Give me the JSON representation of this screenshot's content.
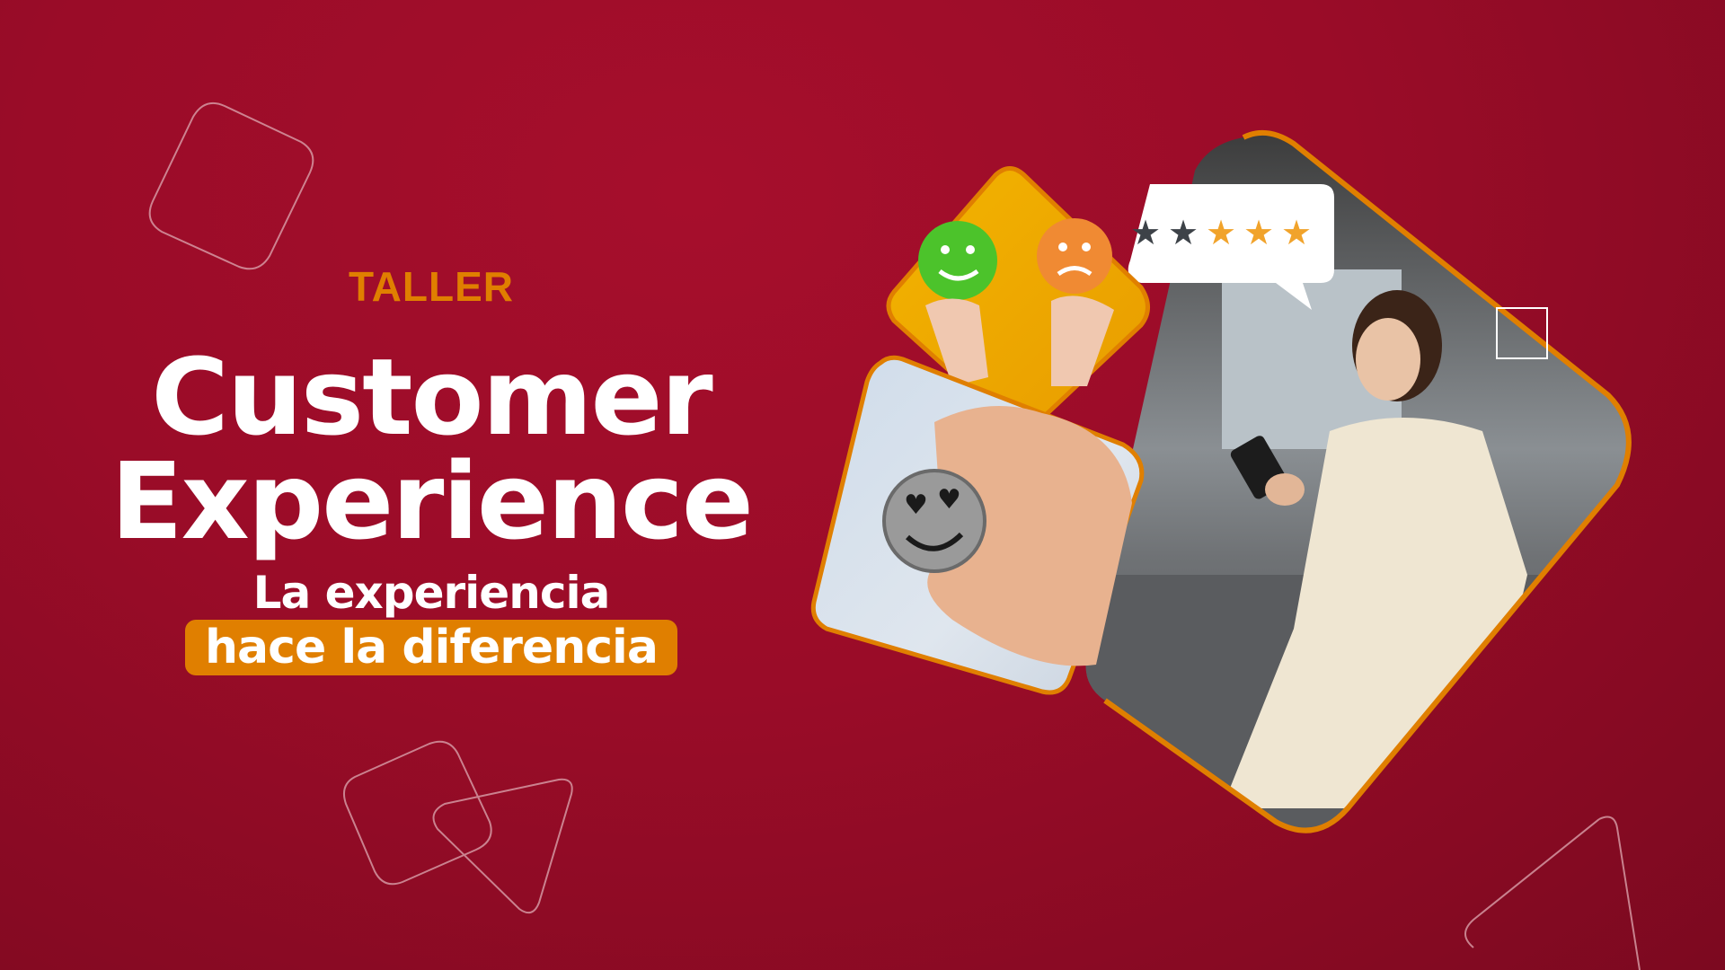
{
  "banner": {
    "eyebrow": "TALLER",
    "title_line1": "Customer",
    "title_line2": "Experience",
    "subtitle": "La experiencia",
    "highlight": "hace la diferencia"
  },
  "rating": {
    "stars_total": 5,
    "stars_filled": 3
  },
  "colors": {
    "background": "#9a0c28",
    "accent": "#e07f00",
    "text": "#ffffff"
  }
}
